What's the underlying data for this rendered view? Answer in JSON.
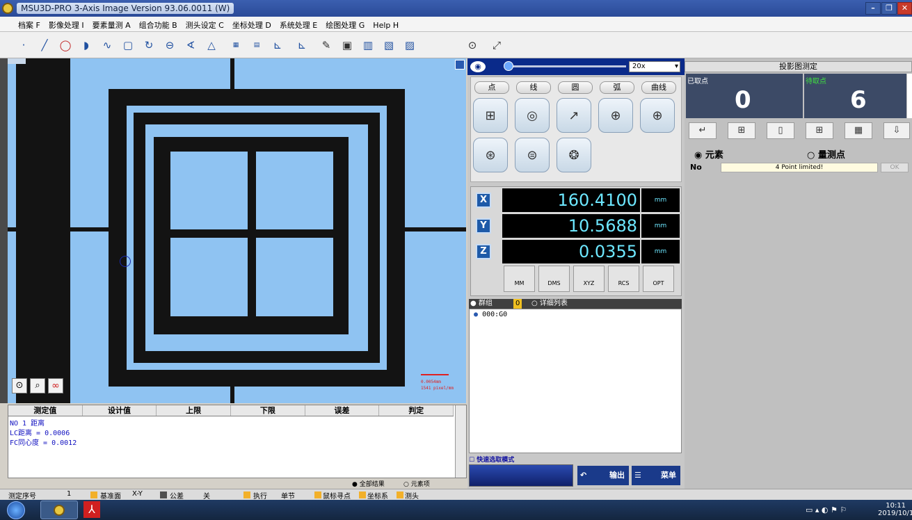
{
  "window": {
    "title": "MSU3D-PRO 3-Axis Image  Version 93.06.0011 (W)"
  },
  "menu": [
    "档案 F",
    "影像处理 I",
    "要素量测 A",
    "组合功能 B",
    "测头设定 C",
    "坐标处理 D",
    "系统处理 E",
    "绘图处理 G",
    "Help H"
  ],
  "view": {
    "scale_text": "0.0054mm",
    "pixel_text": "1541 pixel/mm"
  },
  "results": {
    "columns": [
      "测定值",
      "设计值",
      "上限",
      "下限",
      "误差",
      "判定"
    ],
    "lines": [
      "NO    1 距离",
      "LC距离    =           0.0006",
      "FC同心度 =           0.0012"
    ],
    "radio_all": "全部结果",
    "radio_element": "元素项"
  },
  "statusbar": {
    "seq_label": "测定序号",
    "seq_value": "1",
    "plane_label": "基准面",
    "plane_value": "X-Y",
    "tol_label": "公差",
    "tol_value": "关",
    "exec_label": "执行",
    "exec_value": "单节",
    "mouse_label": "鼠标寻点",
    "coord_label": "坐标系",
    "probe_label": "测头"
  },
  "mid": {
    "zoom_value": "20x",
    "shape_tabs": [
      "点",
      "线",
      "圆",
      "弧",
      "曲线"
    ],
    "axes": [
      {
        "axis": "X",
        "value": "160.4100",
        "unit": "mm"
      },
      {
        "axis": "Y",
        "value": "10.5688",
        "unit": "mm"
      },
      {
        "axis": "Z",
        "value": "0.0355",
        "unit": "mm"
      }
    ],
    "unit_buttons": [
      "MM",
      "DMS",
      "XYZ",
      "RCS",
      "OPT"
    ],
    "tree_tab_group": "群组",
    "tree_tab_count": "0",
    "tree_tab_detail": "详细列表",
    "tree_item": "000:G0",
    "quick_mode": "快速选取模式",
    "output_label": "输出",
    "menu_label": "菜单"
  },
  "right": {
    "header": "投影图测定",
    "taken_label": "已取点",
    "taken_value": "0",
    "pending_label": "待取点",
    "pending_value": "6",
    "radio_element": "元素",
    "radio_points": "量测点",
    "no_label": "No",
    "limit_text": "4 Point limited!",
    "ok_label": "OK"
  },
  "taskbar": {
    "time": "10:11",
    "date": "2019/10/1"
  }
}
